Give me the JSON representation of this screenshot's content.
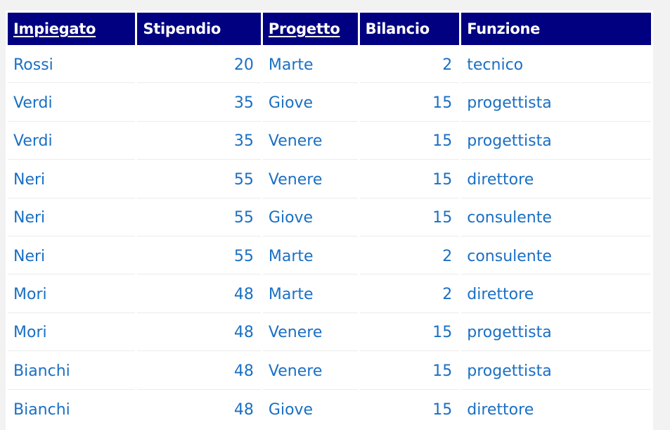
{
  "table": {
    "headers": [
      {
        "label": "Impiegato",
        "key": true
      },
      {
        "label": "Stipendio",
        "key": false
      },
      {
        "label": "Progetto",
        "key": true
      },
      {
        "label": "Bilancio",
        "key": false
      },
      {
        "label": "Funzione",
        "key": false
      }
    ],
    "rows": [
      [
        "Rossi",
        "20",
        "Marte",
        "2",
        "tecnico"
      ],
      [
        "Verdi",
        "35",
        "Giove",
        "15",
        "progettista"
      ],
      [
        "Verdi",
        "35",
        "Venere",
        "15",
        "progettista"
      ],
      [
        "Neri",
        "55",
        "Venere",
        "15",
        "direttore"
      ],
      [
        "Neri",
        "55",
        "Giove",
        "15",
        "consulente"
      ],
      [
        "Neri",
        "55",
        "Marte",
        "2",
        "consulente"
      ],
      [
        "Mori",
        "48",
        "Marte",
        "2",
        "direttore"
      ],
      [
        "Mori",
        "48",
        "Venere",
        "15",
        "progettista"
      ],
      [
        "Bianchi",
        "48",
        "Venere",
        "15",
        "progettista"
      ],
      [
        "Bianchi",
        "48",
        "Giove",
        "15",
        "direttore"
      ]
    ]
  },
  "colors": {
    "header_background": "#000080",
    "header_text": "#ffffff",
    "cell_text": "#1a6fc4",
    "page_background": "#f2f2f2"
  }
}
